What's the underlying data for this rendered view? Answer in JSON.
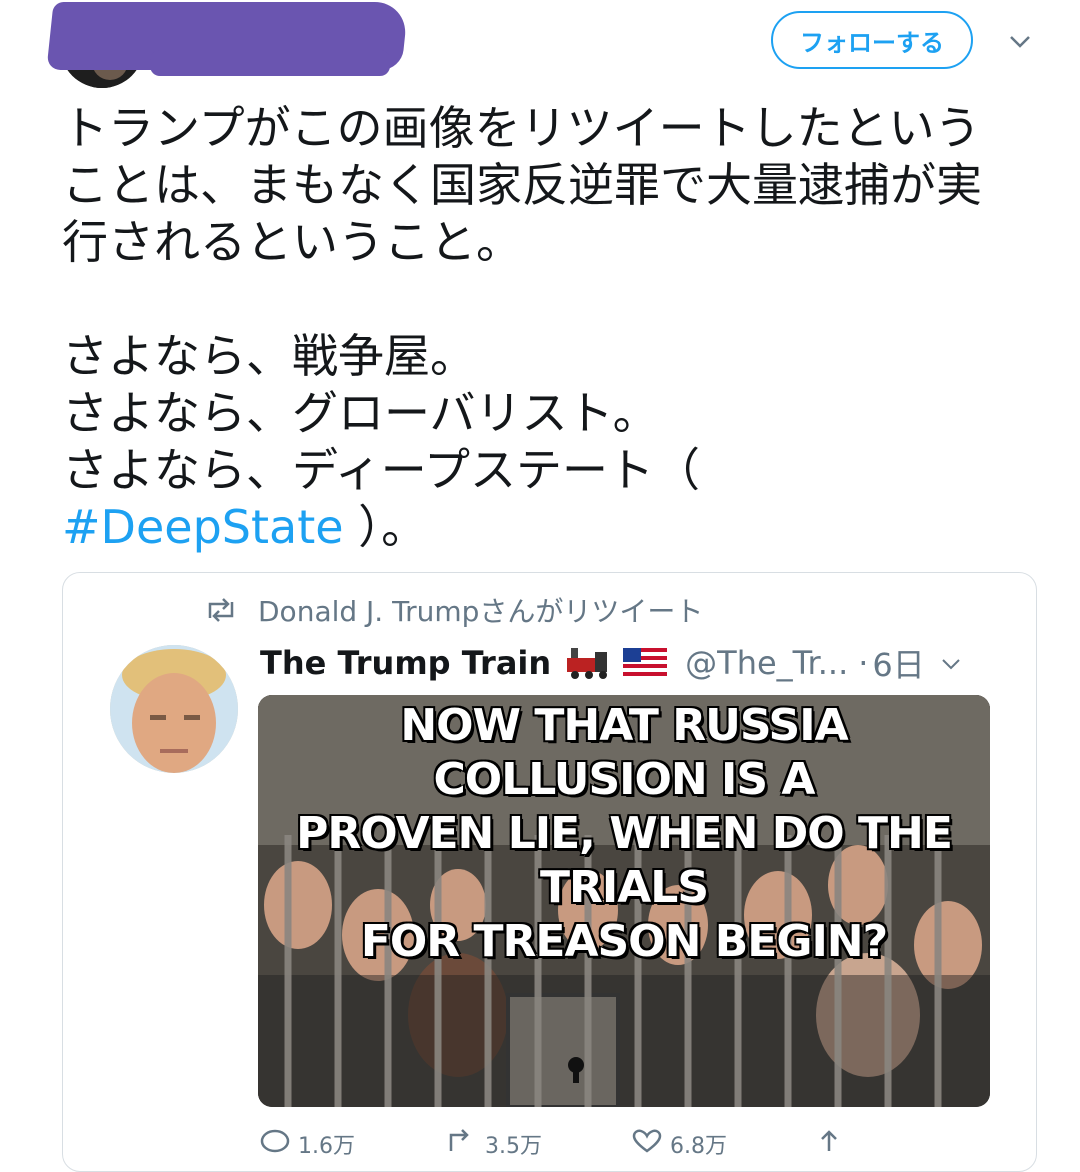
{
  "header": {
    "follow_label": "フォローする",
    "menu_icon": "chevron-down-icon"
  },
  "tweet": {
    "line1": "トランプがこの画像をリツイートしたという",
    "line2": "ことは、まもなく国家反逆罪で大量逮捕が実",
    "line3": "行されるということ。",
    "line4": "さよなら、戦争屋。",
    "line5": "さよなら、グローバリスト。",
    "line6": "さよなら、ディープステート（",
    "hashtag": "#DeepState",
    "line7_end": "）。",
    "colors": {
      "link": "#1da1f2",
      "text": "#14171a",
      "muted": "#657786"
    }
  },
  "quote": {
    "retweet_by": "Donald J. Trumpさんがリツイート",
    "name": "The Trump Train",
    "emojis": [
      "train-icon",
      "us-flag-icon"
    ],
    "handle": "@The_Tr...",
    "separator": "·",
    "time": "6日",
    "meme_line1": "NOW THAT RUSSIA COLLUSION IS A",
    "meme_line2": "PROVEN LIE, WHEN DO THE TRIALS",
    "meme_line3": "FOR TREASON BEGIN?"
  },
  "actions": {
    "reply": "1.6万",
    "retweet": "3.5万",
    "like": "6.8万"
  }
}
